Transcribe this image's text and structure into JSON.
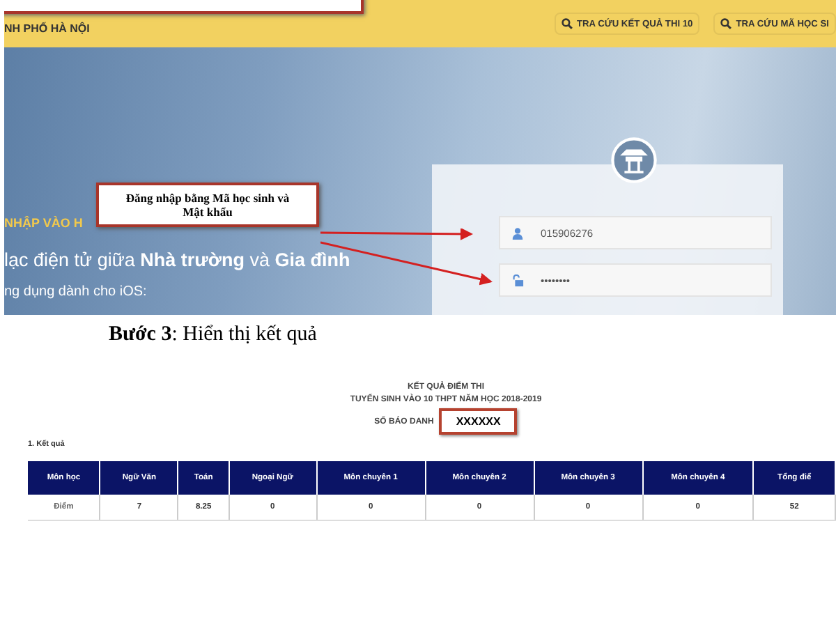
{
  "header": {
    "site_name": "NH PHỐ HÀ NỘI",
    "links": [
      "TRA CỨU KẾT QUẢ THI 10",
      "TRA CỨU MÃ HỌC SI"
    ]
  },
  "hero": {
    "heading": "NHẬP VÀO H",
    "tagline": "lạc điện tử giữa **Nhà trường** và **Gia đình**",
    "subtext": "ng dụng dành cho iOS:"
  },
  "callout": {
    "text": "Đăng nhập bằng Mã học sinh và Mật khẩu"
  },
  "login": {
    "fields": [
      {
        "kind": "user",
        "value": "015906276"
      },
      {
        "kind": "password",
        "value": "••••••••"
      }
    ]
  },
  "step_caption": "**Bước 3**: Hiển thị kết quả",
  "result": {
    "title": "KẾT QUẢ ĐIỂM THI",
    "subtitle": "TUYỂN SINH VÀO 10 THPT NĂM HỌC 2018-2019",
    "id_label": "SỐ BÁO DANH",
    "id_value": "XXXXXX",
    "section": "1. Kết quả",
    "table": {
      "columns": [
        "Môn học",
        "Ngữ Văn",
        "Toán",
        "Ngoại Ngữ",
        "Môn chuyên 1",
        "Môn chuyên 2",
        "Môn chuyên 3",
        "Môn chuyên 4",
        "Tổng điể"
      ],
      "rows": [
        [
          "Điểm",
          "7",
          "8.25",
          "0",
          "0",
          "0",
          "0",
          "0",
          "52"
        ]
      ]
    }
  }
}
